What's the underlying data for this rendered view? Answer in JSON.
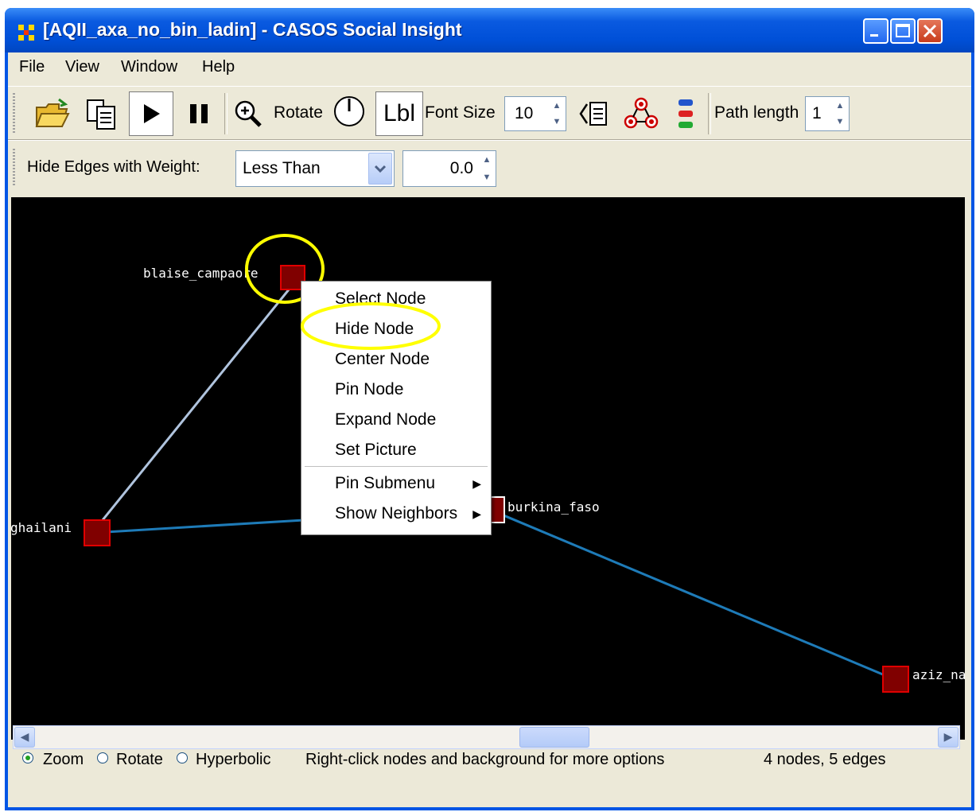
{
  "window": {
    "title": "[AQII_axa_no_bin_ladin] - CASOS Social Insight"
  },
  "menubar": {
    "items": [
      "File",
      "View",
      "Window",
      "Help"
    ]
  },
  "toolbar": {
    "rotate_label": "Rotate",
    "lbl_label": "Lbl",
    "font_size_label": "Font Size",
    "font_size_value": "10",
    "path_length_label": "Path length",
    "path_length_value": "1"
  },
  "filter": {
    "label": "Hide Edges with Weight:",
    "comparison": "Less Than",
    "value": "0.0"
  },
  "graph": {
    "nodes": {
      "blaise": "blaise_campaore",
      "ghailani": "ghailani",
      "burkina": "burkina_faso",
      "aziz": "aziz_na"
    },
    "colors": {
      "node_fill": "#800000",
      "node_border": "#e00000",
      "edge_light": "#b0c4de",
      "edge_blue": "#1e7bb8",
      "highlight": "#ffff00"
    }
  },
  "context_menu": {
    "items": [
      "Select Node",
      "Hide Node",
      "Center Node",
      "Pin Node",
      "Expand Node",
      "Set Picture"
    ],
    "submenus": [
      "Pin Submenu",
      "Show Neighbors"
    ]
  },
  "status": {
    "modes": [
      "Zoom",
      "Rotate",
      "Hyperbolic"
    ],
    "selected_mode": "Zoom",
    "hint": "Right-click nodes and background for more options",
    "count": "4 nodes, 5 edges"
  }
}
